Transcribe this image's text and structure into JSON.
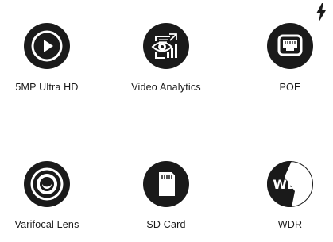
{
  "features": [
    {
      "label": "5MP Ultra HD",
      "icon": "play-icon"
    },
    {
      "label": "Video Analytics",
      "icon": "eye-analytics-icon"
    },
    {
      "label": "POE",
      "icon": "ethernet-port-icon"
    },
    {
      "label": "Varifocal Lens",
      "icon": "lens-icon"
    },
    {
      "label": "SD Card",
      "icon": "sd-card-icon"
    },
    {
      "label": "WDR",
      "icon": "wdr-icon"
    }
  ],
  "wdr_icon_text": "WDR",
  "colors": {
    "icon_fill": "#1a1a1a",
    "text": "#1a1a1a",
    "background": "#ffffff"
  }
}
